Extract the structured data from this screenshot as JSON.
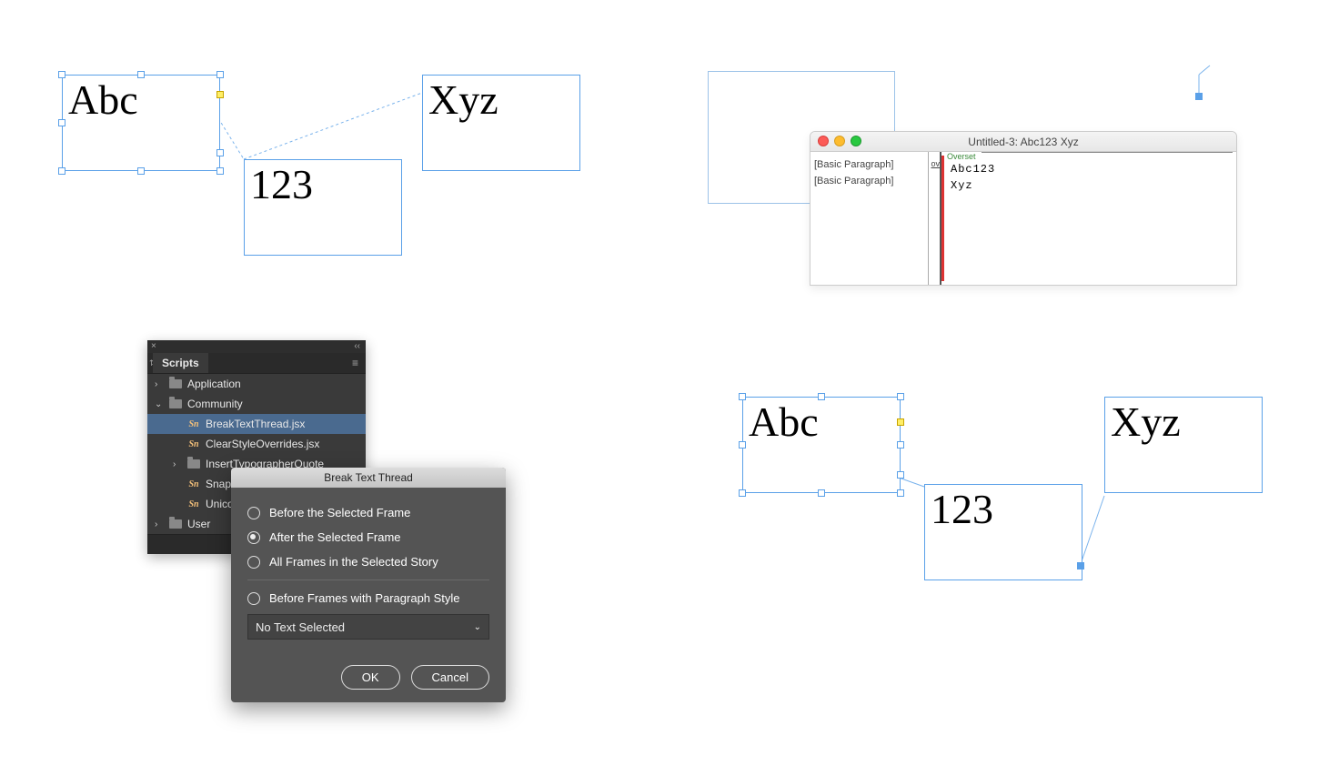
{
  "q1": {
    "frame1": "Abc",
    "frame2": "123",
    "frame3": "Xyz"
  },
  "q2": {
    "window_title": "Untitled-3: Abc123 Xyz",
    "style1": "[Basic Paragraph]",
    "style2": "[Basic Paragraph]",
    "ov": "ov",
    "overset_label": "Overset",
    "line1": "Abc123",
    "line2": "Xyz"
  },
  "q3": {
    "tab": "Scripts",
    "folders": {
      "app": "Application",
      "community": "Community",
      "user": "User"
    },
    "scripts": {
      "s1": "BreakTextThread.jsx",
      "s2": "ClearStyleOverrides.jsx",
      "s3": "InsertTypographerQuote",
      "s4": "Snap",
      "s5": "Unico"
    },
    "dialog": {
      "title": "Break Text Thread",
      "opt1": "Before the Selected Frame",
      "opt2": "After the Selected Frame",
      "opt3": "All Frames in the Selected Story",
      "opt4": "Before Frames with Paragraph Style",
      "dropdown": "No Text Selected",
      "ok": "OK",
      "cancel": "Cancel"
    }
  },
  "q4": {
    "frame1": "Abc",
    "frame2": "123",
    "frame3": "Xyz"
  }
}
